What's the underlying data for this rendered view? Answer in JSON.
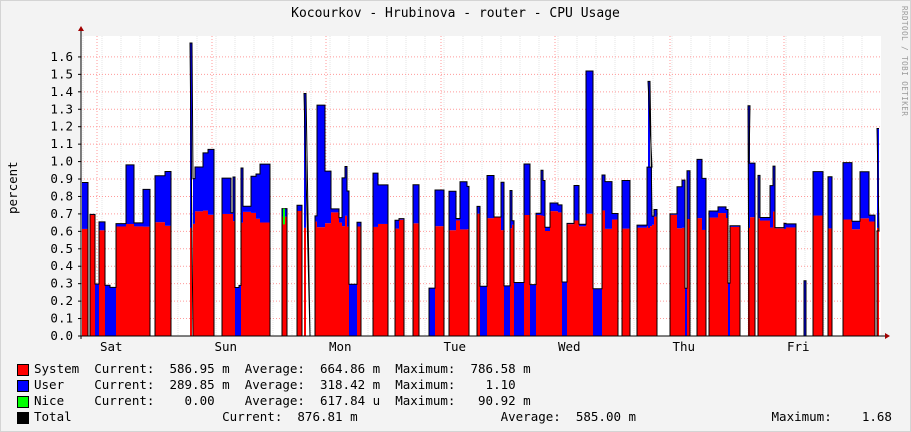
{
  "title": "Kocourkov - Hrubinova - router - CPU Usage",
  "watermark": "RRDTOOL / TOBI OETIKER",
  "chart_data": {
    "type": "area",
    "ylabel": "percent",
    "ylim": [
      0,
      1.72
    ],
    "y_ticks": [
      "0.0",
      "0.1",
      "0.2",
      "0.3",
      "0.4",
      "0.5",
      "0.6",
      "0.7",
      "0.8",
      "0.9",
      "1.0",
      "1.1",
      "1.2",
      "1.3",
      "1.4",
      "1.5",
      "1.6"
    ],
    "x_ticks": [
      "Sat",
      "Sun",
      "Mon",
      "Tue",
      "Wed",
      "Thu",
      "Fri"
    ],
    "grid": true,
    "series": [
      {
        "name": "System",
        "color": "#ff0000"
      },
      {
        "name": "User",
        "color": "#0000ff"
      },
      {
        "name": "Nice",
        "color": "#00ff00"
      },
      {
        "name": "Total",
        "color": "#000000"
      }
    ]
  },
  "legend": [
    {
      "name": "System",
      "color": "#ff0000",
      "text": "System  Current:  586.95 m  Average:  664.86 m  Maximum:  786.58 m"
    },
    {
      "name": "User",
      "color": "#0000ff",
      "text": "User    Current:  289.85 m  Average:  318.42 m  Maximum:    1.10"
    },
    {
      "name": "Nice",
      "color": "#00ff00",
      "text": "Nice    Current:    0.00    Average:  617.84 u  Maximum:   90.92 m"
    },
    {
      "name": "Total",
      "color": "#000000",
      "text": "Total                    Current:  876.81 m                   Average:  585.00 m                  Maximum:    1.68"
    }
  ]
}
